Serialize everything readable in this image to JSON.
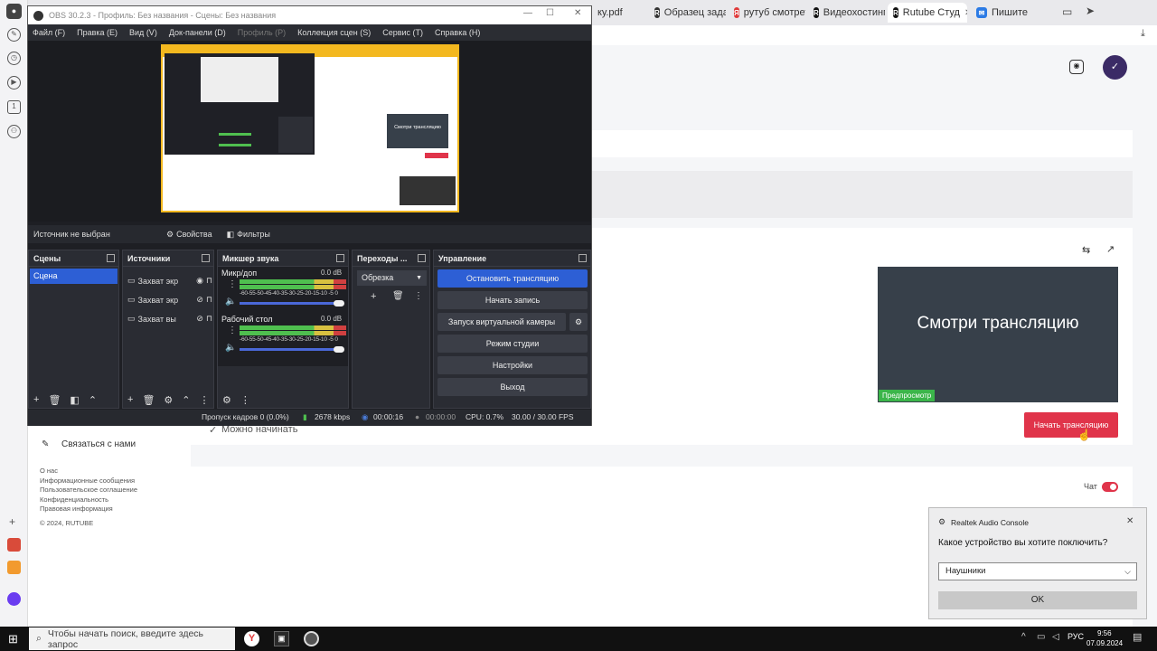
{
  "browser": {
    "tabs": [
      {
        "label": "ку.pdf"
      },
      {
        "label": "Образец задан"
      },
      {
        "label": "рутуб смотреть"
      },
      {
        "label": "Видеохостинг"
      },
      {
        "label": "Rutube Студ"
      },
      {
        "label": "Пишите"
      }
    ]
  },
  "rutube": {
    "contact_label": "Связаться с нами",
    "can_start": "Можно начинать",
    "footer_links": [
      "О нас",
      "Информационные сообщения",
      "Пользовательское соглашение",
      "Конфиденциальность",
      "Правовая информация"
    ],
    "copyright": "© 2024, RUTUBE",
    "preview_text": "Смотри трансляцию",
    "preview_badge": "Предпросмотр",
    "start_button": "Начать трансляцию",
    "chat_label": "Чат"
  },
  "obs": {
    "title": "OBS 30.2.3 - Профиль: Без названия - Сцены: Без названия",
    "menu": [
      "Файл (F)",
      "Правка (E)",
      "Вид (V)",
      "Док-панели (D)",
      "Профиль (P)",
      "Коллекция сцен (S)",
      "Сервис (T)",
      "Справка (H)"
    ],
    "no_source": "Источник не выбран",
    "properties": "Свойства",
    "filters": "Фильтры",
    "panels": {
      "scenes": "Сцены",
      "sources": "Источники",
      "mixer": "Микшер звука",
      "transitions": "Переходы ...",
      "controls": "Управление"
    },
    "scene_item": "Сцена",
    "sources": [
      "Захват экр",
      "Захват экр",
      "Захват вы"
    ],
    "mixer": [
      {
        "name": "Микр/доп",
        "db": "0.0 dB"
      },
      {
        "name": "Рабочий стол",
        "db": "0.0 dB"
      }
    ],
    "meter_scale": "-60-55-50-45-40-35-30-25-20-15-10 -5  0",
    "transition": "Обрезка",
    "controls": [
      "Остановить трансляцию",
      "Начать запись",
      "Запуск виртуальной камеры",
      "Режим студии",
      "Настройки",
      "Выход"
    ],
    "status": {
      "dropped": "Пропуск кадров 0 (0.0%)",
      "kbps": "2678 kbps",
      "stream_time": "00:00:16",
      "rec_time": "00:00:00",
      "cpu": "CPU: 0.7%",
      "fps": "30.00 / 30.00 FPS"
    },
    "preview_mini": "Смотри трансляцию"
  },
  "realtek": {
    "title": "Realtek Audio Console",
    "question": "Какое устройство вы хотите поключить?",
    "select_value": "Наушники",
    "ok": "OK"
  },
  "taskbar": {
    "search_placeholder": "Чтобы начать поиск, введите здесь запрос",
    "lang": "РУС",
    "time": "9:56",
    "date": "07.09.2024"
  },
  "colors": {
    "accent_red": "#e0344a",
    "obs_blue": "#2d5fd5",
    "preview_green": "#3bb54a"
  }
}
